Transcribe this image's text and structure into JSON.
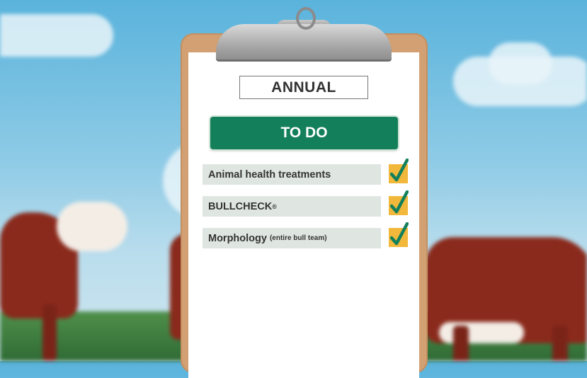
{
  "header": {
    "title": "ANNUAL"
  },
  "todo": {
    "label": "TO DO"
  },
  "tasks": [
    {
      "label": "Animal health treatments",
      "checked": true
    },
    {
      "label": "BULLCHECK",
      "sup": "®",
      "checked": true
    },
    {
      "label": "Morphology",
      "note": "(entire bull team)",
      "checked": true
    }
  ],
  "colors": {
    "button_green": "#137f5b",
    "check_box": "#f2b83b",
    "check_mark": "#137f5b",
    "clipboard": "#d2a072"
  }
}
